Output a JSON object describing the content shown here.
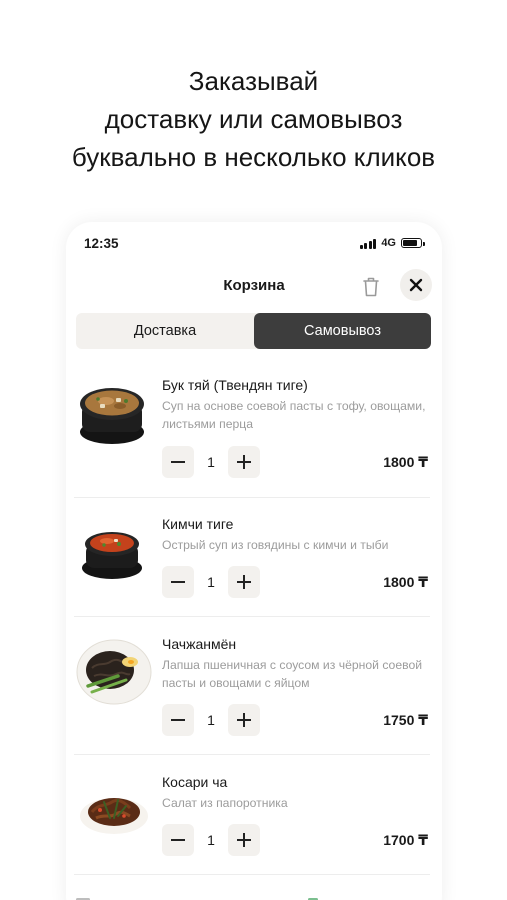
{
  "headline": {
    "line1": "Заказывай",
    "line2": "доставку или самовывоз",
    "line3": "буквально в несколько кликов"
  },
  "status_bar": {
    "time": "12:35",
    "network": "4G"
  },
  "cart": {
    "title": "Корзина",
    "tabs": {
      "delivery": "Доставка",
      "pickup": "Самовывоз",
      "selected": "pickup"
    },
    "items": [
      {
        "name": "Бук тяй (Твендян тиге)",
        "description": "Суп на основе соевой пасты с тофу, овощами, листьями перца",
        "quantity": "1",
        "price": "1800 ₸"
      },
      {
        "name": "Кимчи тиге",
        "description": "Острый суп из говядины с кимчи и тыби",
        "quantity": "1",
        "price": "1800 ₸"
      },
      {
        "name": "Чачжанмён",
        "description": "Лапша пшеничная с соусом из чёрной соевой пасты и овощами с яйцом",
        "quantity": "1",
        "price": "1750 ₸"
      },
      {
        "name": "Косари ча",
        "description": "Салат из папоротника",
        "quantity": "1",
        "price": "1700 ₸"
      }
    ]
  },
  "colors": {
    "accent_dark": "#3d3d3d",
    "surface": "#f3f1ee",
    "muted_text": "#9c9c9c"
  },
  "icons": [
    "trash-icon",
    "close-icon",
    "signal-icon",
    "battery-icon",
    "minus-icon",
    "plus-icon"
  ]
}
